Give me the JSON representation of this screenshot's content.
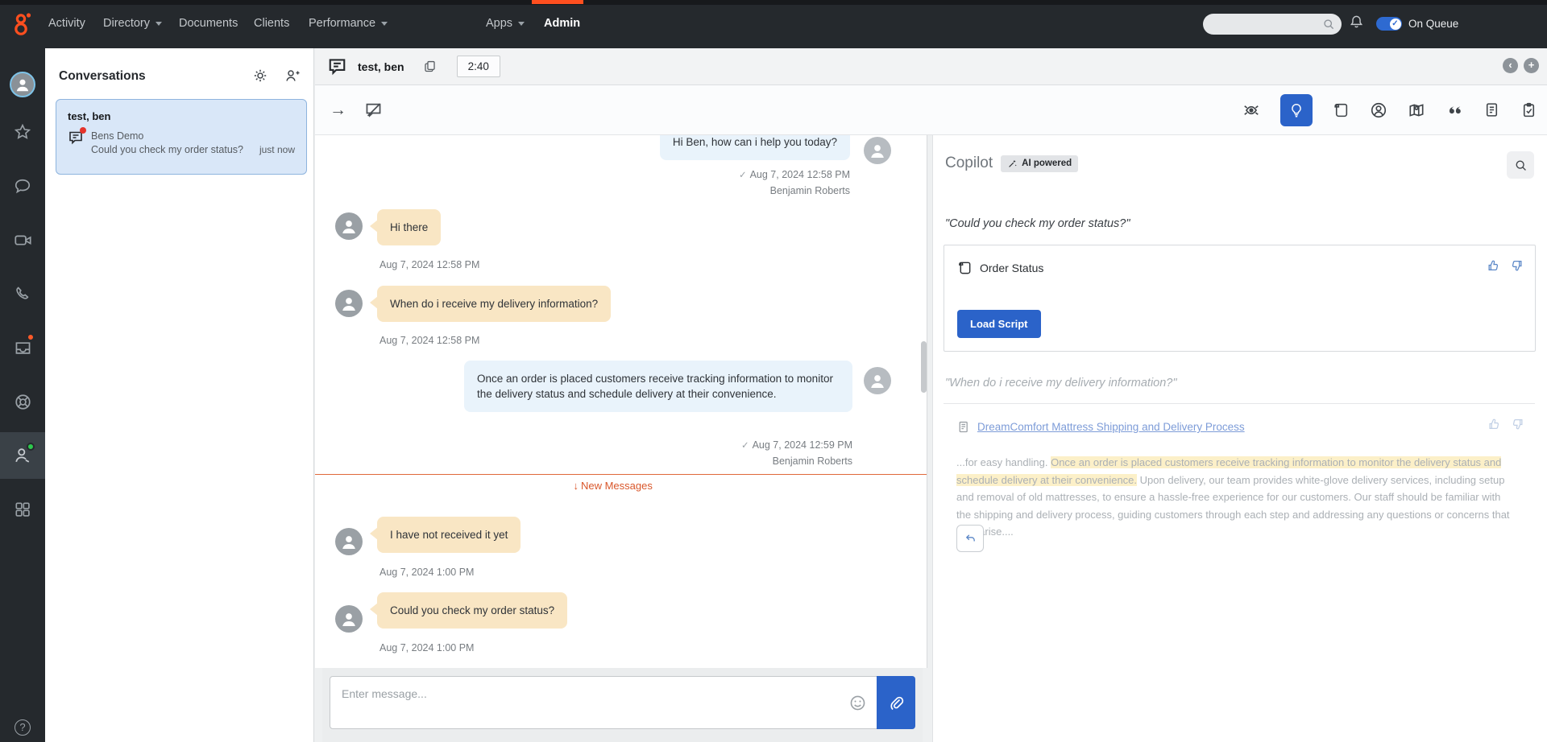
{
  "topnav": {
    "items": [
      {
        "label": "Activity"
      },
      {
        "label": "Directory",
        "dropdown": true
      },
      {
        "label": "Documents"
      },
      {
        "label": "Clients"
      },
      {
        "label": "Performance",
        "dropdown": true
      },
      {
        "label": "Apps",
        "dropdown": true
      },
      {
        "label": "Admin",
        "active": true
      }
    ],
    "on_queue_label": "On Queue",
    "search_value": ""
  },
  "conversations": {
    "title": "Conversations",
    "item": {
      "name": "test, ben",
      "flow": "Bens Demo",
      "preview": "Could you check my order status?",
      "time": "just now"
    }
  },
  "interaction": {
    "name": "test, ben",
    "timer": "2:40",
    "new_messages_label": "New Messages",
    "input_placeholder": "Enter message...",
    "messages": [
      {
        "from": "agent",
        "text": "Hi Ben, how can i help you today?",
        "time": "Aug 7, 2024 12:58 PM",
        "author": "Benjamin Roberts"
      },
      {
        "from": "customer",
        "text": "Hi there",
        "time": "Aug 7, 2024 12:58 PM"
      },
      {
        "from": "customer",
        "text": "When do i receive my delivery information?",
        "time": "Aug 7, 2024 12:58 PM"
      },
      {
        "from": "agent",
        "text": "Once an order is placed customers receive tracking information to monitor the delivery status and schedule delivery at their convenience.",
        "time": "Aug 7, 2024 12:59 PM",
        "author": "Benjamin Roberts"
      },
      {
        "from": "customer",
        "text": "I have not received it yet",
        "time": "Aug 7, 2024 1:00 PM"
      },
      {
        "from": "customer",
        "text": "Could you check my order status?",
        "time": "Aug 7, 2024 1:00 PM"
      }
    ]
  },
  "copilot": {
    "title": "Copilot",
    "badge": "AI powered",
    "suggestion1": {
      "quote": "\"Could you check my order status?\"",
      "title": "Order Status",
      "button": "Load Script"
    },
    "suggestion2": {
      "quote": "\"When do i receive my delivery information?\"",
      "link": "DreamComfort Mattress Shipping and Delivery Process",
      "snippet_prefix": "...for easy handling. ",
      "snippet_highlight": "Once an order is placed customers receive tracking information to monitor the delivery status and schedule delivery at their convenience.",
      "snippet_suffix": " Upon delivery, our team provides white-glove delivery services, including setup and removal of old mattresses, to ensure a hassle-free experience for our customers. Our staff should be familiar with the shipping and delivery process, guiding customers through each step and addressing any questions or concerns that may arise...."
    }
  },
  "glyphs": {
    "check": "✓",
    "down_arrow": "↓",
    "arrow_right": "→",
    "chevron_left": "‹",
    "plus": "+",
    "question": "?"
  },
  "colors": {
    "brand_orange": "#ff4f1f",
    "primary_blue": "#2b63c9",
    "customer_bubble": "#f9e6c4",
    "agent_bubble": "#e9f3fb",
    "snippet_highlight": "#fcf0c8",
    "presence_green": "#2dc84d",
    "alert_red": "#e5342c",
    "new_messages_orange": "#d9572b"
  }
}
